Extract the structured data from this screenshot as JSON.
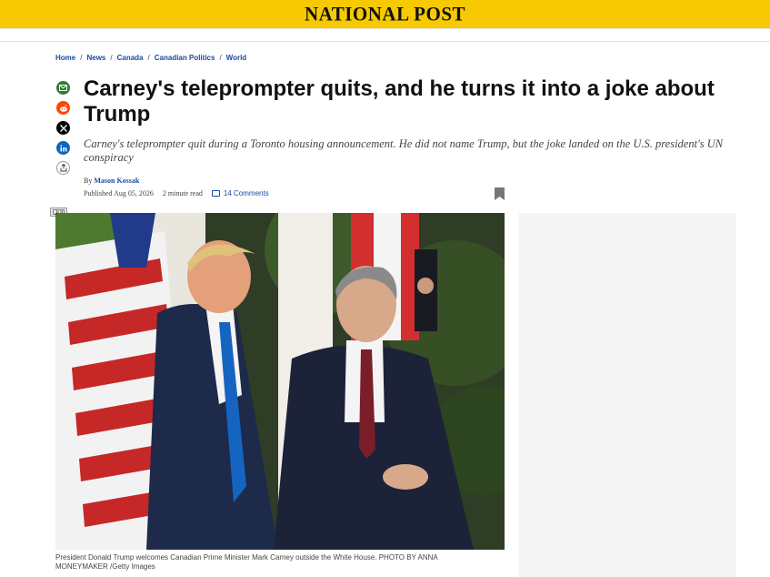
{
  "header": {
    "logo_text": "NATIONAL POST",
    "accent_color": "#f7c900"
  },
  "breadcrumb": {
    "items": [
      "Home",
      "News",
      "Canada",
      "Canadian Politics",
      "World"
    ],
    "separator": "/"
  },
  "share": {
    "icons": [
      "email-icon",
      "reddit-icon",
      "x-icon",
      "linkedin-icon",
      "more-share-icon"
    ]
  },
  "article": {
    "headline": "Carney's teleprompter quits, and he turns it into a joke about Trump",
    "dek": "Carney's teleprompter quit during a Toronto housing announcement. He did not name Trump, but the joke landed on the U.S. president's UN conspiracy",
    "byline_prefix": "By",
    "author": "Mason Kossak",
    "published": "Published Aug 05, 2026",
    "read_time": "2 minute read",
    "comments": "14 Comments"
  },
  "image": {
    "caption": "President Donald Trump welcomes Canadian Prime Minister Mark Carney outside the White House. PHOTO BY ANNA MONEYMAKER /Getty Images"
  }
}
